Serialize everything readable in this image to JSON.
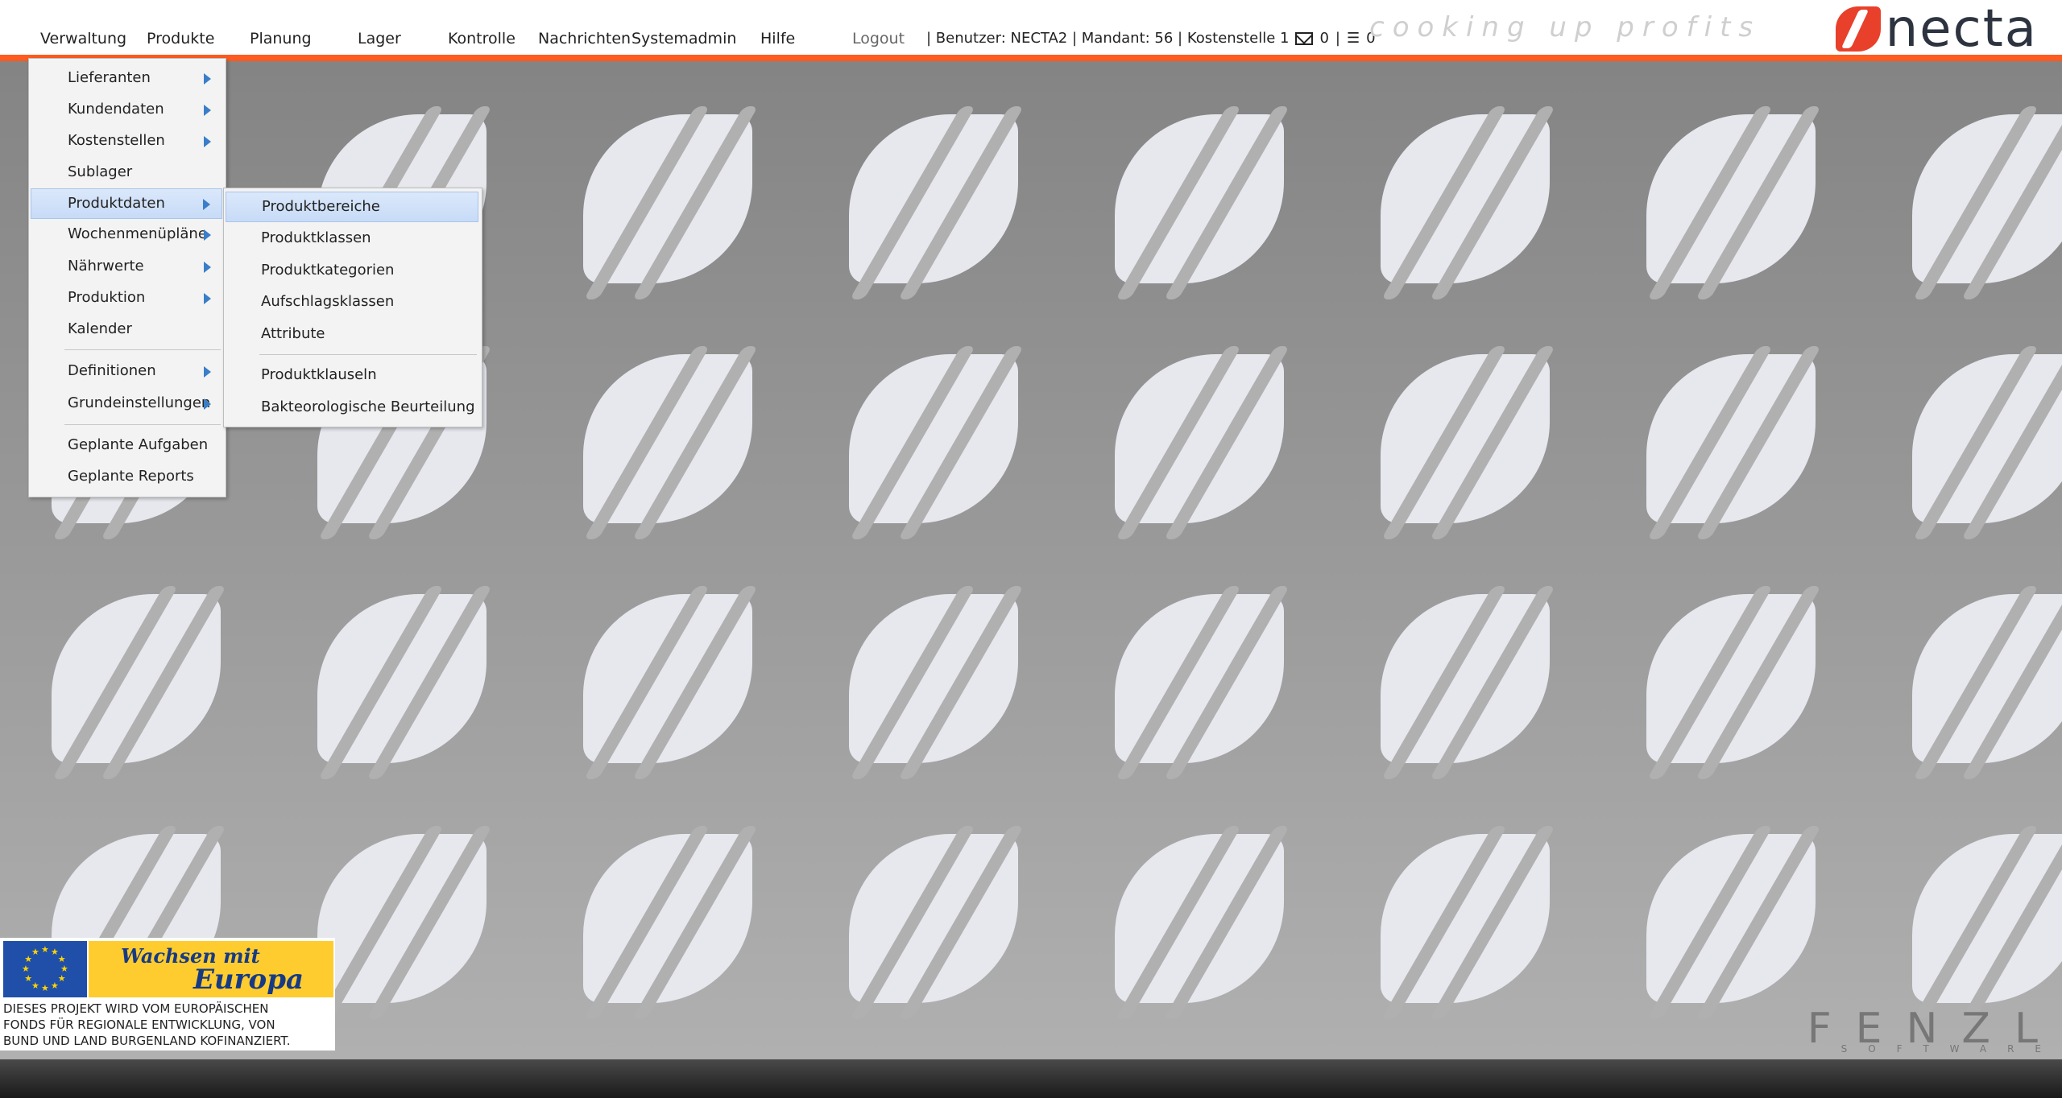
{
  "menubar": {
    "items": [
      {
        "label": "Verwaltung"
      },
      {
        "label": "Produkte"
      },
      {
        "label": "Planung"
      },
      {
        "label": "Lager"
      },
      {
        "label": "Kontrolle"
      },
      {
        "label": "Nachrichten"
      },
      {
        "label": "Systemadmin"
      },
      {
        "label": "Hilfe"
      }
    ],
    "logout": "Logout"
  },
  "status": {
    "text": "| Benutzer: NECTA2 | Mandant: 56 | Kostenstelle 1",
    "messages_count": "0",
    "separator": "|",
    "tasks_count": "0"
  },
  "branding": {
    "tagline": "cooking up profits",
    "logo_text": "necta",
    "accent_color": "#ff5a1f",
    "logo_color": "#e8402a"
  },
  "verwaltung_menu": {
    "items": [
      {
        "label": "Lieferanten"
      },
      {
        "label": "Kundendaten"
      },
      {
        "label": "Kostenstellen"
      },
      {
        "label": "Sublager"
      },
      {
        "label": "Produktdaten"
      },
      {
        "label": "Wochenmenüpläne"
      },
      {
        "label": "Nährwerte"
      },
      {
        "label": "Produktion"
      },
      {
        "label": "Kalender"
      },
      {
        "label": "Definitionen"
      },
      {
        "label": "Grundeinstellungen"
      },
      {
        "label": "Geplante Aufgaben"
      },
      {
        "label": "Geplante Reports"
      }
    ]
  },
  "produktdaten_submenu": {
    "items": [
      {
        "label": "Produktbereiche"
      },
      {
        "label": "Produktklassen"
      },
      {
        "label": "Produktkategorien"
      },
      {
        "label": "Aufschlagsklassen"
      },
      {
        "label": "Attribute"
      },
      {
        "label": "Produktklauseln"
      },
      {
        "label": "Bakteorologische Beurteilung"
      }
    ]
  },
  "eu_banner": {
    "title_line1": "Wachsen mit",
    "title_line2": "Europa",
    "text_lines": [
      "DIESES PROJEKT WIRD VOM EUROPÄISCHEN",
      "FONDS FÜR REGIONALE ENTWICKLUNG, VON",
      "BUND UND LAND BURGENLAND KOFINANZIERT."
    ]
  },
  "watermark": {
    "title": "FENZL",
    "subtitle": "SOFTWARE"
  }
}
